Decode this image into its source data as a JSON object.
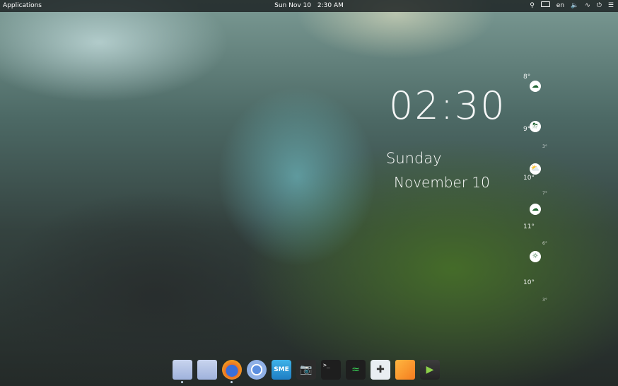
{
  "panel": {
    "applications_label": "Applications",
    "clock_date": "Sun Nov 10",
    "clock_time": "2:30 AM",
    "language": "en",
    "tray_icons": [
      "search-icon",
      "keyboard-icon",
      "volume-icon",
      "wifi-icon",
      "power-icon",
      "menu-icon"
    ]
  },
  "desktop_widget": {
    "time": "02:30",
    "day": "Sunday",
    "date": "November 10"
  },
  "weather": [
    {
      "temp": "8°",
      "sub": "",
      "icon": "rain-cloud-icon"
    },
    {
      "temp": "9°",
      "sub": "3°",
      "icon": "storm-cloud-icon"
    },
    {
      "temp": "10°",
      "sub": "7°",
      "icon": "partly-cloudy-icon"
    },
    {
      "temp": "11°",
      "sub": "6°",
      "icon": "cloud-icon"
    },
    {
      "temp": "10°",
      "sub": "3°",
      "icon": "sun-cloud-icon"
    }
  ],
  "dock": {
    "items": [
      {
        "name": "files",
        "label": "",
        "running": true
      },
      {
        "name": "folder",
        "label": "",
        "running": false
      },
      {
        "name": "firefox",
        "label": "",
        "running": true
      },
      {
        "name": "chromium",
        "label": "",
        "running": false
      },
      {
        "name": "sme",
        "label": "SME",
        "running": false
      },
      {
        "name": "screenshot-camera",
        "label": "",
        "running": false
      },
      {
        "name": "terminal",
        "label": ">_",
        "running": false
      },
      {
        "name": "system-monitor",
        "label": "",
        "running": false
      },
      {
        "name": "screenshot-tool",
        "label": "",
        "running": false
      },
      {
        "name": "text-editor",
        "label": "",
        "running": false
      },
      {
        "name": "media-player",
        "label": "",
        "running": false
      }
    ]
  }
}
